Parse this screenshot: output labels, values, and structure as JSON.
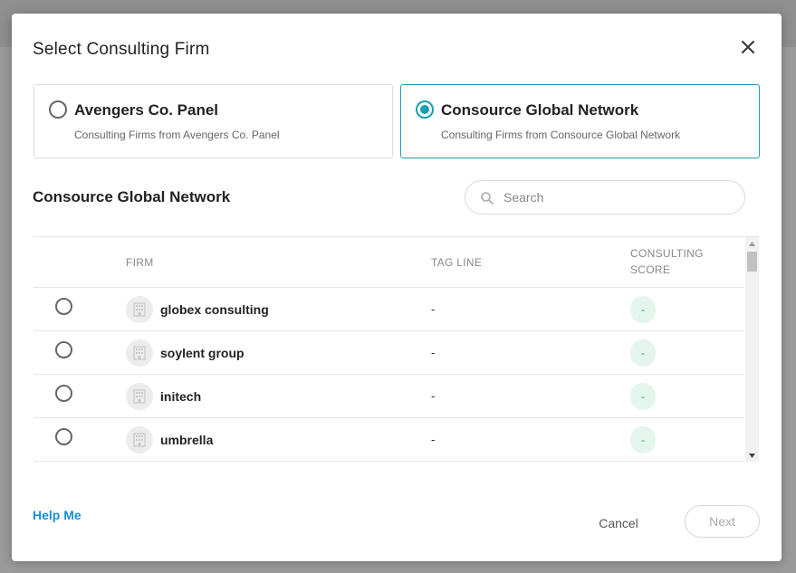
{
  "modal": {
    "title": "Select Consulting Firm"
  },
  "options": [
    {
      "title": "Avengers Co. Panel",
      "subtitle": "Consulting Firms from Avengers Co. Panel",
      "selected": false
    },
    {
      "title": "Consource Global Network",
      "subtitle": "Consulting Firms from Consource Global Network",
      "selected": true
    }
  ],
  "section": {
    "title": "Consource Global Network"
  },
  "search": {
    "placeholder": "Search",
    "value": ""
  },
  "table": {
    "headers": {
      "firm": "FIRM",
      "tag_line": "TAG LINE",
      "score_line1": "CONSULTING",
      "score_line2": "SCORE"
    },
    "rows": [
      {
        "firm": "globex consulting",
        "tag_line": "-",
        "score": "-"
      },
      {
        "firm": "soylent group",
        "tag_line": "-",
        "score": "-"
      },
      {
        "firm": "initech",
        "tag_line": "-",
        "score": "-"
      },
      {
        "firm": "umbrella",
        "tag_line": "-",
        "score": "-"
      }
    ]
  },
  "footer": {
    "help_label": "Help Me",
    "cancel_label": "Cancel",
    "next_label": "Next"
  },
  "colors": {
    "accent": "#1a9fb3",
    "link": "#1a8fd8",
    "score_bg": "#e3f5ec",
    "score_text": "#2e9a6a"
  },
  "icons": {
    "close": "close-icon",
    "search": "search-icon",
    "firm_avatar": "building-icon",
    "scroll_up": "caret-up-icon",
    "scroll_down": "caret-down-icon"
  }
}
